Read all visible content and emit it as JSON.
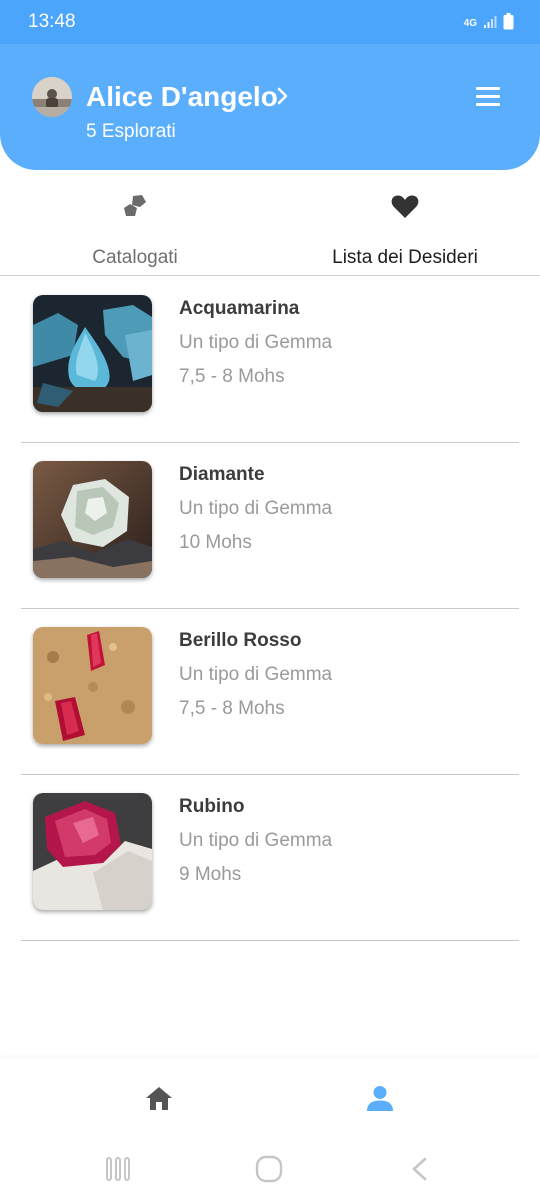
{
  "status_bar": {
    "time": "13:48",
    "network": "4G",
    "icons": [
      "signal-icon",
      "battery-icon"
    ]
  },
  "header": {
    "user_name": "Alice D'angelo",
    "explored_count": "5 Esplorati",
    "background_color": "#5aaefb",
    "icons": [
      "avatar",
      "chevron-right-icon",
      "menu-icon"
    ]
  },
  "tabs": [
    {
      "label": "Catalogati",
      "icon": "rocks-icon",
      "active": false
    },
    {
      "label": "Lista dei Desideri",
      "icon": "heart-icon",
      "active": true
    }
  ],
  "items": [
    {
      "name": "Acquamarina",
      "type": "Un tipo di Gemma",
      "hardness": "7,5 - 8 Mohs",
      "thumbnail": "aquamarine-image"
    },
    {
      "name": "Diamante",
      "type": "Un tipo di Gemma",
      "hardness": "10 Mohs",
      "thumbnail": "diamond-image"
    },
    {
      "name": "Berillo Rosso",
      "type": "Un tipo di Gemma",
      "hardness": "7,5 - 8 Mohs",
      "thumbnail": "red-beryl-image"
    },
    {
      "name": "Rubino",
      "type": "Un tipo di Gemma",
      "hardness": "9 Mohs",
      "thumbnail": "ruby-image"
    }
  ],
  "bottom_nav": {
    "items": [
      {
        "icon": "home-icon",
        "active": false
      },
      {
        "icon": "profile-icon",
        "active": true
      }
    ],
    "active_color": "#5aaefb"
  },
  "system_nav": {
    "icons": [
      "recents-icon",
      "home-circle-icon",
      "back-icon"
    ]
  }
}
